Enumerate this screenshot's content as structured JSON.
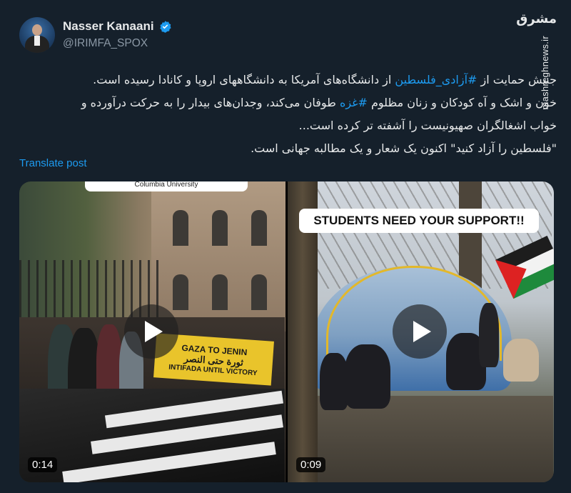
{
  "author": {
    "name": "Nasser Kanaani",
    "handle": "@IRIMFA_SPOX",
    "verified_icon": "verified-badge-icon"
  },
  "watermark": {
    "logo_text": "مشرق",
    "url": "mashreghnews.ir"
  },
  "post": {
    "lines": [
      [
        "جنبش حمایت از ",
        "#آزادی_فلسطین",
        " از دانشگاه‌های آمریکا به دانشگاههای اروپا و کانادا  رسیده است."
      ],
      [
        "خون و اشک و آه کودکان و زنان مظلوم ",
        "#غزه",
        " طوفان می‌کند، وجدان‌های بیدار را به حرکت درآورده و"
      ],
      [
        "خواب اشغالگران صهیونیست را آشفته تر کرده است..."
      ],
      [
        "\"فلسطین را آزاد کنید\" اکنون یک شعار و یک مطالبه جهانی است."
      ]
    ],
    "translate_label": "Translate post"
  },
  "videos": [
    {
      "duration": "0:14",
      "top_caption": "Columbia University",
      "banner_line1": "GAZA TO JENIN",
      "banner_line2": "ثورة حتى النصر",
      "banner_line3": "INTIFADA UNTIL VICTORY"
    },
    {
      "duration": "0:09",
      "overlay_text": "STUDENTS NEED YOUR SUPPORT!!"
    }
  ],
  "colors": {
    "background": "#15202b",
    "text": "#e7e9ea",
    "muted": "#8b98a5",
    "link": "#1d9bf0"
  }
}
